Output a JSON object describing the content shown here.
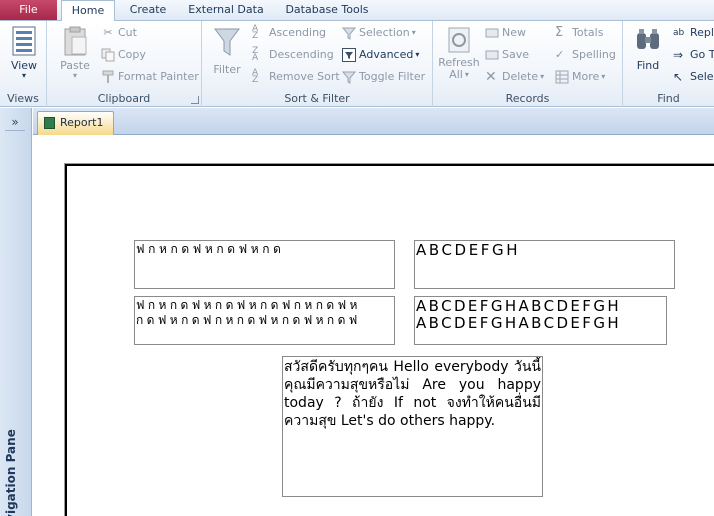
{
  "tabs": {
    "file": "File",
    "home": "Home",
    "create": "Create",
    "external_data": "External Data",
    "database_tools": "Database Tools"
  },
  "ribbon": {
    "views": {
      "view_label": "View",
      "group_label": "Views"
    },
    "clipboard": {
      "paste": "Paste",
      "cut": "Cut",
      "copy": "Copy",
      "format_painter": "Format Painter",
      "group_label": "Clipboard"
    },
    "sort_filter": {
      "filter": "Filter",
      "ascending": "Ascending",
      "descending": "Descending",
      "remove_sort": "Remove Sort",
      "selection": "Selection",
      "advanced": "Advanced",
      "toggle_filter": "Toggle Filter",
      "group_label": "Sort & Filter"
    },
    "records": {
      "refresh": "Refresh",
      "refresh_sub": "All",
      "new": "New",
      "save": "Save",
      "delete": "Delete",
      "totals": "Totals",
      "spelling": "Spelling",
      "more": "More",
      "group_label": "Records"
    },
    "find": {
      "find": "Find",
      "replace": "Repl",
      "goto": "Go T",
      "select": "Sele",
      "group_label": "Find"
    }
  },
  "nav_pane": {
    "toggle": "»",
    "label": "Navigation Pane"
  },
  "document": {
    "tab_label": "Report1",
    "fields": {
      "thai_single": "ฟกหกดฟหกดฟหกด",
      "latin_single": "ABCDEFGH",
      "thai_line1": "ฟกหกดฟหกดฟหกดฟกหกดฟห",
      "thai_line2": "กดฟหกดฟกหกดฟหกดฟหกดฟ",
      "latin_line1": "ABCDEFGHABCDEFGH",
      "latin_line2": "ABCDEFGHABCDEFGH",
      "mixed_text": "สวัสดีครับทุกๆคน Hello everybody วันนี้คุณมีความสุขหรือไม่ Are you happy today ? ถ้ายัง If not จงทำให้คนอื่นมีความสุข Let's do others happy."
    }
  }
}
